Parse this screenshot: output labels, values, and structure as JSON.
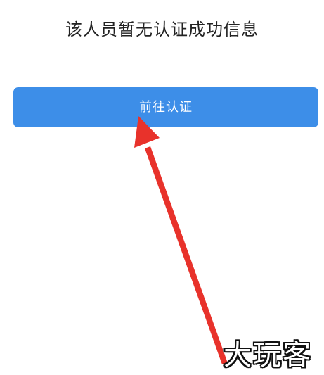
{
  "message": "该人员暂无认证成功信息",
  "auth_button": {
    "label": "前往认证"
  },
  "colors": {
    "button": "#3d8ee8",
    "arrow": "#e8322b"
  },
  "watermark": "大玩客"
}
